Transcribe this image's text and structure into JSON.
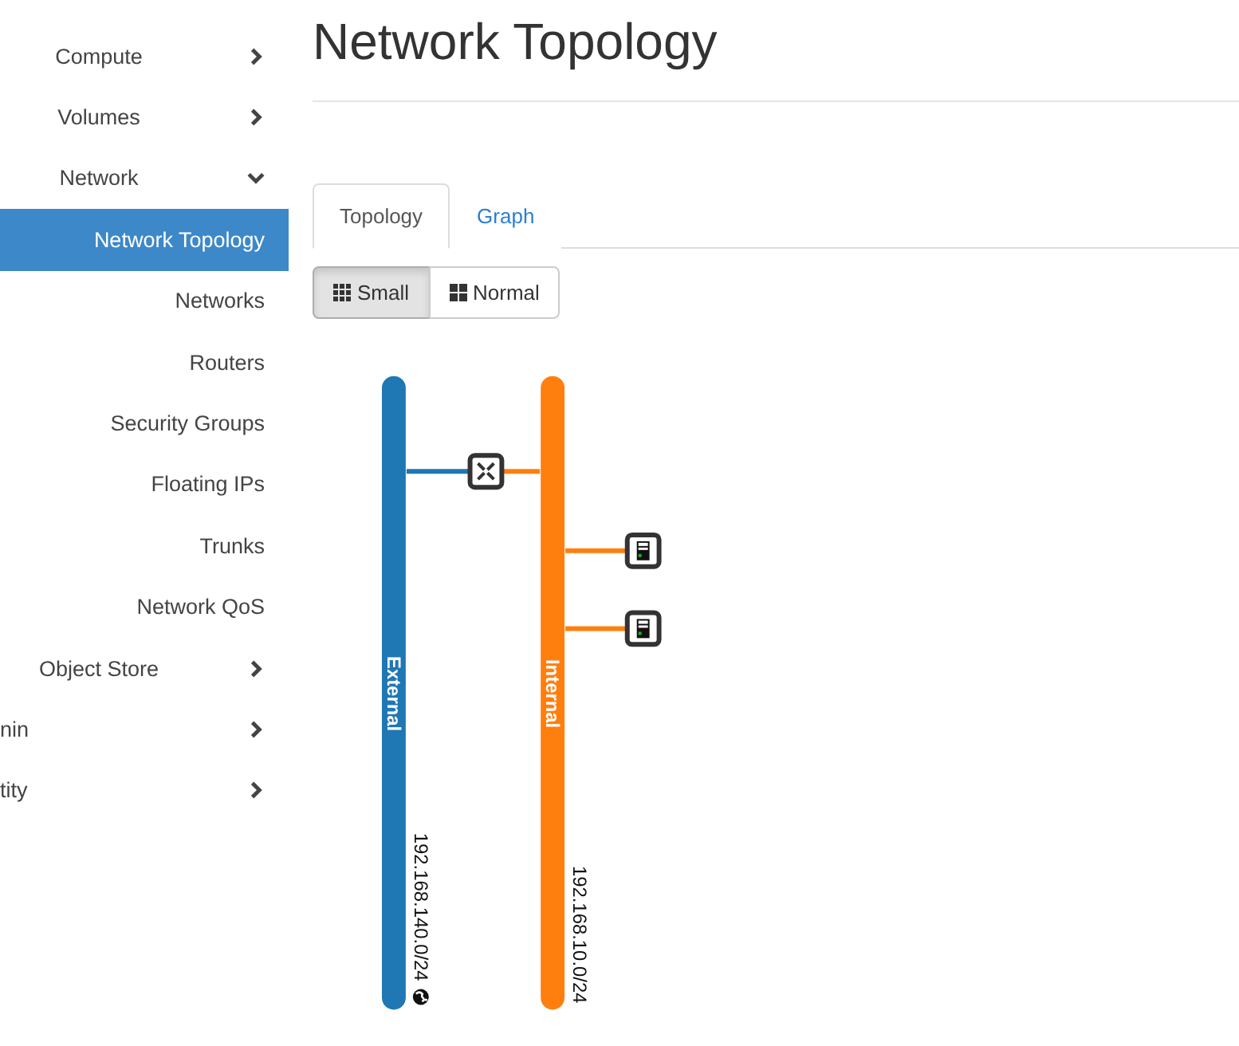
{
  "sidebar": {
    "items": [
      {
        "label": "Compute",
        "kind": "group",
        "expanded": false,
        "selected": false
      },
      {
        "label": "Volumes",
        "kind": "group",
        "expanded": false,
        "selected": false
      },
      {
        "label": "Network",
        "kind": "group",
        "expanded": true,
        "selected": false
      },
      {
        "label": "Network Topology",
        "kind": "panel",
        "selected": true
      },
      {
        "label": "Networks",
        "kind": "panel",
        "selected": false
      },
      {
        "label": "Routers",
        "kind": "panel",
        "selected": false
      },
      {
        "label": "Security Groups",
        "kind": "panel",
        "selected": false
      },
      {
        "label": "Floating IPs",
        "kind": "panel",
        "selected": false
      },
      {
        "label": "Trunks",
        "kind": "panel",
        "selected": false
      },
      {
        "label": "Network QoS",
        "kind": "panel",
        "selected": false
      },
      {
        "label": "Object Store",
        "kind": "group",
        "expanded": false,
        "selected": false
      },
      {
        "label": "nin",
        "kind": "dashboard",
        "expanded": false,
        "selected": false
      },
      {
        "label": "tity",
        "kind": "dashboard",
        "expanded": false,
        "selected": false
      }
    ]
  },
  "page": {
    "title": "Network Topology"
  },
  "tabs": [
    {
      "label": "Topology",
      "selected": true
    },
    {
      "label": "Graph",
      "selected": false
    }
  ],
  "view_buttons": [
    {
      "label": "Small",
      "kind": "small",
      "selected": true
    },
    {
      "label": "Normal",
      "kind": "normal",
      "selected": false
    }
  ],
  "topology": {
    "networks": [
      {
        "name": "External",
        "cidr": "192.168.140.0/24",
        "color": "#1f77b4",
        "external": true
      },
      {
        "name": "Internal",
        "cidr": "192.168.10.0/24",
        "color": "#ff7f0e",
        "external": false
      }
    ],
    "devices": [
      {
        "kind": "router"
      },
      {
        "kind": "instance"
      },
      {
        "kind": "instance"
      }
    ]
  }
}
